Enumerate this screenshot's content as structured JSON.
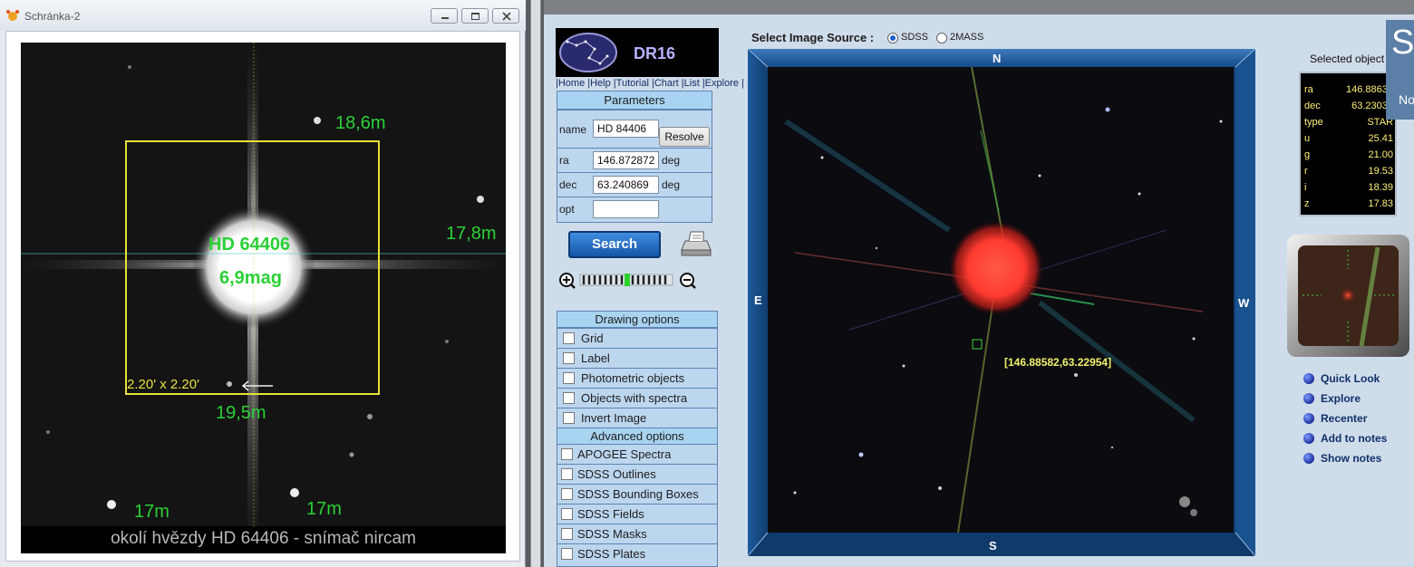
{
  "left_window": {
    "title": "Schránka-2",
    "annotations": {
      "star_name": "HD 64406",
      "star_mag": "6,9mag",
      "mag_top": "18,6m",
      "mag_right": "17,8m",
      "mag_bottom": "19,5m",
      "mag_bl": "17m",
      "mag_br": "17m",
      "box_size": "2.20' x 2.20'"
    },
    "caption": "okolí hvězdy HD 64406  - snímač nircam"
  },
  "navigator": {
    "logo_text": "DR16",
    "nav_links": "|Home |Help |Tutorial |Chart |List |Explore |",
    "parameters": {
      "title": "Parameters",
      "name_label": "name",
      "name_value": "HD 84406",
      "resolve_label": "Resolve",
      "ra_label": "ra",
      "ra_value": "146.872872",
      "ra_unit": "deg",
      "dec_label": "dec",
      "dec_value": "63.240869",
      "dec_unit": "deg",
      "opt_label": "opt",
      "opt_value": ""
    },
    "search_label": "Search",
    "drawing_options": {
      "title": "Drawing options",
      "items": [
        "Grid",
        "Label",
        "Photometric objects",
        "Objects with spectra",
        "Invert Image"
      ]
    },
    "advanced_options": {
      "title": "Advanced options",
      "items": [
        "APOGEE Spectra",
        "SDSS Outlines",
        "SDSS Bounding Boxes",
        "SDSS Fields",
        "SDSS Masks",
        "SDSS Plates"
      ]
    },
    "image_source": {
      "label": "Select Image Source :",
      "options": [
        "SDSS",
        "2MASS"
      ],
      "selected": "SDSS"
    },
    "compass": {
      "n": "N",
      "s": "S",
      "e": "E",
      "w": "W"
    },
    "coord_label": "[146.88582,63.22954]",
    "selected_object": {
      "title": "Selected object",
      "rows": [
        {
          "key": "ra",
          "value": "146.88630"
        },
        {
          "key": "dec",
          "value": "63.23032"
        },
        {
          "key": "type",
          "value": "STAR"
        },
        {
          "key": "u",
          "value": "25.41"
        },
        {
          "key": "g",
          "value": "21.00"
        },
        {
          "key": "r",
          "value": "19.53"
        },
        {
          "key": "i",
          "value": "18.39"
        },
        {
          "key": "z",
          "value": "17.83"
        }
      ]
    },
    "side_tab": {
      "big": "S",
      "small": "No"
    },
    "actions": [
      "Quick Look",
      "Explore",
      "Recenter",
      "Add to notes",
      "Show notes"
    ],
    "colors": {
      "accent": "#1655a6",
      "panel": "#a9d4f1",
      "annotation_green": "#2ad136",
      "box_yellow": "#e6e13a"
    }
  }
}
